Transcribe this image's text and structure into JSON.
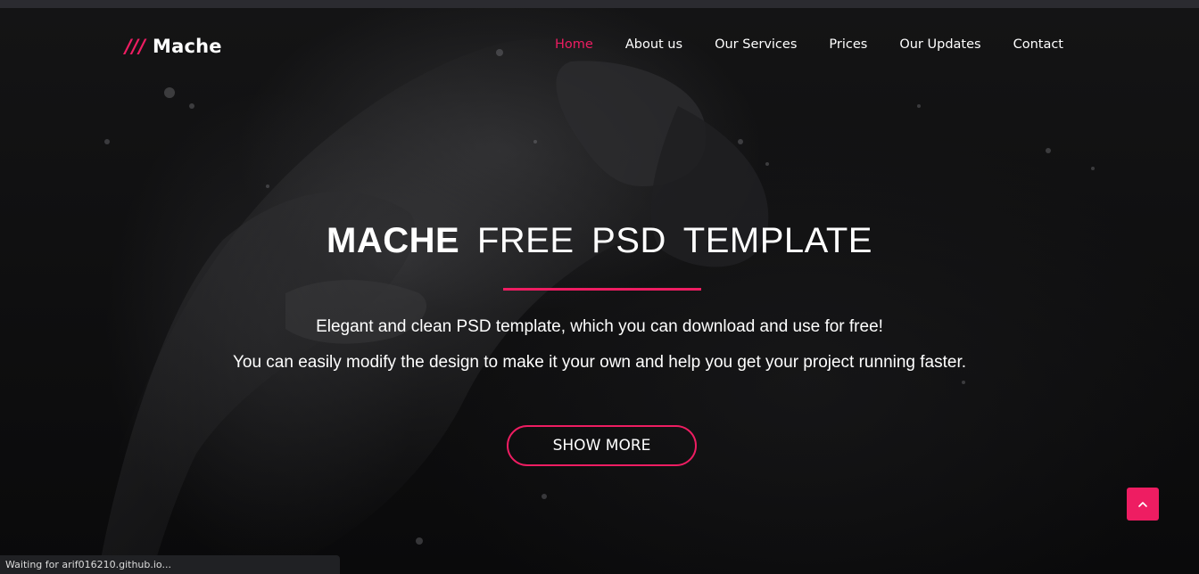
{
  "logo": {
    "slashes": "///",
    "name": "Mache"
  },
  "nav": {
    "items": [
      {
        "label": "Home",
        "active": true
      },
      {
        "label": "About us"
      },
      {
        "label": "Our Services"
      },
      {
        "label": "Prices"
      },
      {
        "label": "Our Updates"
      },
      {
        "label": "Contact"
      }
    ]
  },
  "hero": {
    "title_strong": "MACHE",
    "title_rest": "FREE PSD TEMPLATE",
    "tagline_1": "Elegant and clean PSD template, which you can download and use for free!",
    "tagline_2": "You can easily modify the design to make it your own and help you get your project running faster.",
    "cta_label": "SHOW MORE"
  },
  "back_to_top_icon": "chevron-up-icon",
  "status_bar": {
    "text": "Waiting for arif016210.github.io..."
  },
  "colors": {
    "accent": "#ee1d62",
    "background": "#0c0c0d",
    "text": "#ffffff"
  }
}
